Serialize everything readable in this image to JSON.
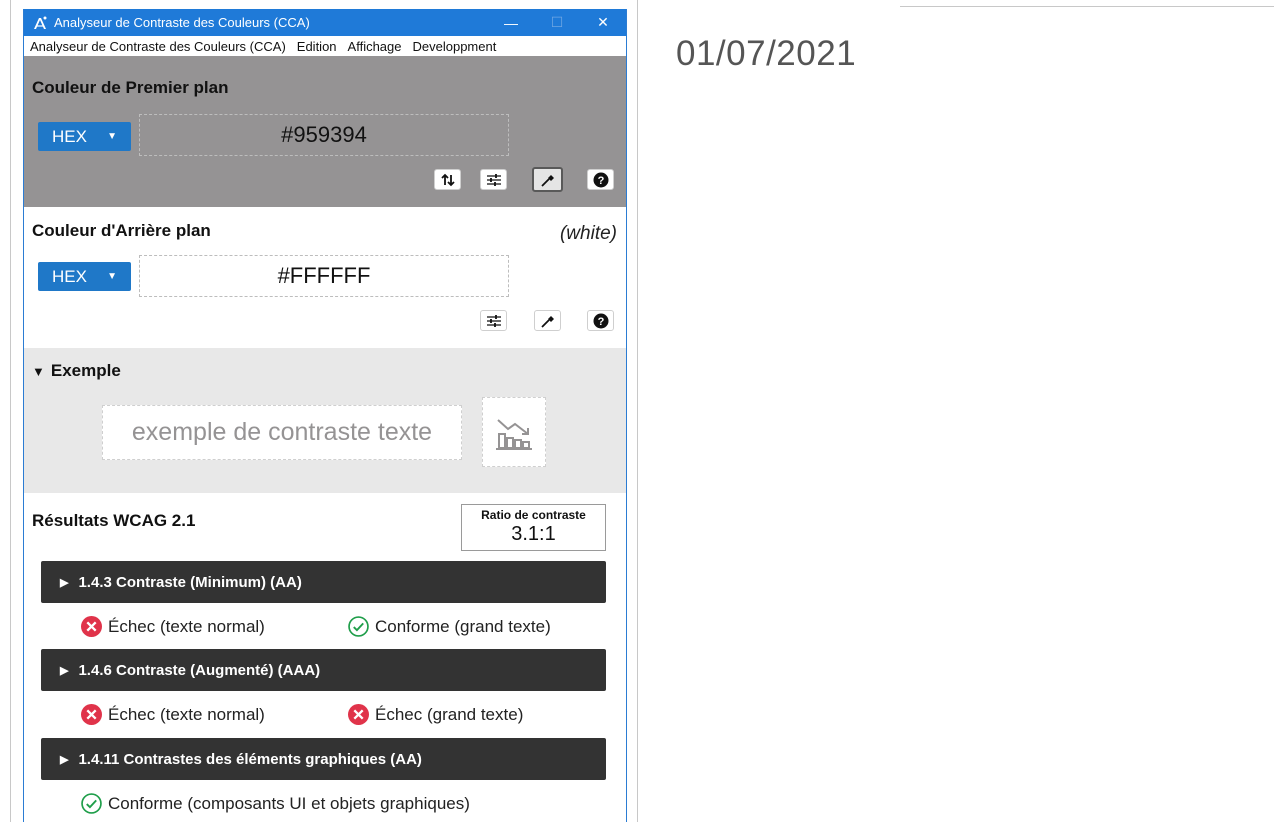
{
  "background": {
    "date": "01/07/2021"
  },
  "window": {
    "title": "Analyseur de Contraste des Couleurs (CCA)",
    "controls": {
      "minimize": "—",
      "maximize": "☐",
      "close": "✕"
    }
  },
  "menu": {
    "items": [
      "Analyseur de Contraste des Couleurs (CCA)",
      "Edition",
      "Affichage",
      "Developpment"
    ]
  },
  "foreground": {
    "title": "Couleur de Premier plan",
    "format": "HEX",
    "value": "#959394",
    "color": "#959394"
  },
  "background_color": {
    "title": "Couleur d'Arrière plan",
    "name_hint": "(white)",
    "format": "HEX",
    "value": "#FFFFFF",
    "color": "#FFFFFF"
  },
  "example": {
    "title": "Exemple",
    "sample_text": "exemple de contraste texte"
  },
  "results": {
    "title": "Résultats WCAG 2.1",
    "ratio_label": "Ratio de contraste",
    "ratio_value": "3.1:1",
    "criteria": [
      {
        "label": "1.4.3 Contraste (Minimum) (AA)",
        "outcomes": [
          {
            "status": "fail",
            "text": "Échec (texte normal)"
          },
          {
            "status": "pass",
            "text": "Conforme (grand texte)"
          }
        ]
      },
      {
        "label": "1.4.6 Contraste (Augmenté) (AAA)",
        "outcomes": [
          {
            "status": "fail",
            "text": "Échec (texte normal)"
          },
          {
            "status": "fail",
            "text": "Échec (grand texte)"
          }
        ]
      },
      {
        "label": "1.4.11 Contrastes des éléments graphiques (AA)",
        "outcomes": [
          {
            "status": "pass",
            "text": "Conforme (composants UI et objets graphiques)"
          }
        ]
      }
    ]
  },
  "colors": {
    "accent": "#1f7ad8",
    "fail": "#e0334a",
    "pass": "#1f9e4a",
    "criterion_bar": "#333333"
  }
}
